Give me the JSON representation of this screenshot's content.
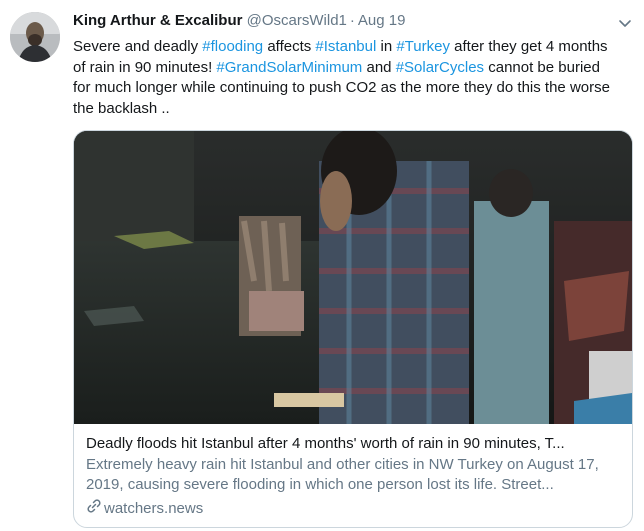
{
  "tweet": {
    "author_name": "King Arthur & Excalibur",
    "handle": "@OscarsWild1",
    "separator": "·",
    "date": "Aug 19",
    "text_parts": {
      "p1": "Severe and deadly ",
      "h1": "#flooding",
      "p2": " affects ",
      "h2": "#Istanbul",
      "p3": " in ",
      "h3": "#Turkey",
      "p4": " after they get 4 months of rain in 90 minutes! ",
      "h4": "#GrandSolarMinimum",
      "p5": " and ",
      "h5": "#SolarCycles",
      "p6": " cannot be buried for much longer while continuing to push CO2 as the more they do this the worse the backlash .."
    }
  },
  "card": {
    "title": "Deadly floods hit Istanbul after 4 months' worth of rain in 90 minutes, T...",
    "description": "Extremely heavy rain hit Istanbul and other cities in NW Turkey on August 17, 2019, causing severe flooding in which one person lost its life. Street...",
    "domain": "watchers.news"
  },
  "colors": {
    "hashtag": "#1b95e0",
    "secondary_text": "#657786",
    "border": "#ccd6dd"
  },
  "icons": [
    "avatar",
    "chevron-down-icon",
    "link-icon"
  ]
}
